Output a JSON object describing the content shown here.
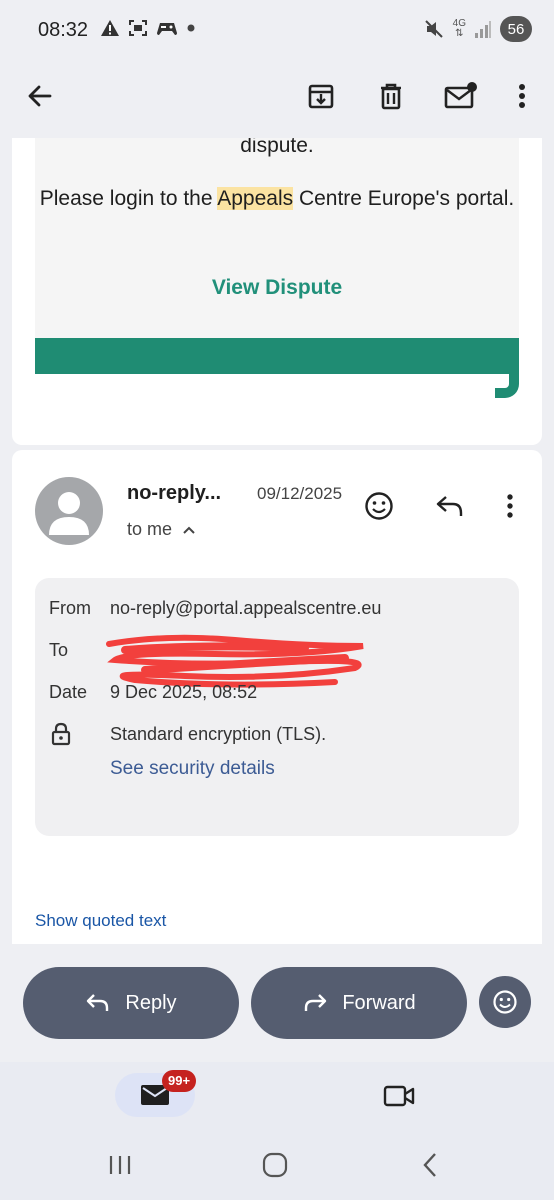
{
  "status_bar": {
    "time": "08:32",
    "network": "4G",
    "battery": "56",
    "icons_left": [
      "warning-icon",
      "screenshot-icon",
      "game-icon",
      "dot-icon"
    ],
    "icons_right": [
      "mute-icon",
      "signal-icon",
      "battery-icon"
    ]
  },
  "app_bar": {
    "icons": [
      "back-arrow-icon",
      "archive-icon",
      "delete-icon",
      "mark-unread-icon",
      "more-vert-icon"
    ]
  },
  "email_body": {
    "fragment": "dispute.",
    "para_prefix": "Please login to the ",
    "highlight": "Appeals",
    "para_suffix": " Centre Europe's portal.",
    "link": "View Dispute",
    "accent": "#1f8c73"
  },
  "message": {
    "sender": "no-reply...",
    "date": "09/12/2025",
    "to_me": "to me",
    "details": {
      "from_label": "From",
      "from_value": "no-reply@portal.appealscentre.eu",
      "to_label": "To",
      "date_label": "Date",
      "date_value": "9 Dec 2025, 08:52",
      "encryption": "Standard encryption (TLS).",
      "security_link": "See security details"
    },
    "show_quoted": "Show quoted text"
  },
  "actions": {
    "reply": "Reply",
    "forward": "Forward"
  },
  "bottom_nav": {
    "badge": "99+",
    "badge_color": "#c5221f"
  }
}
